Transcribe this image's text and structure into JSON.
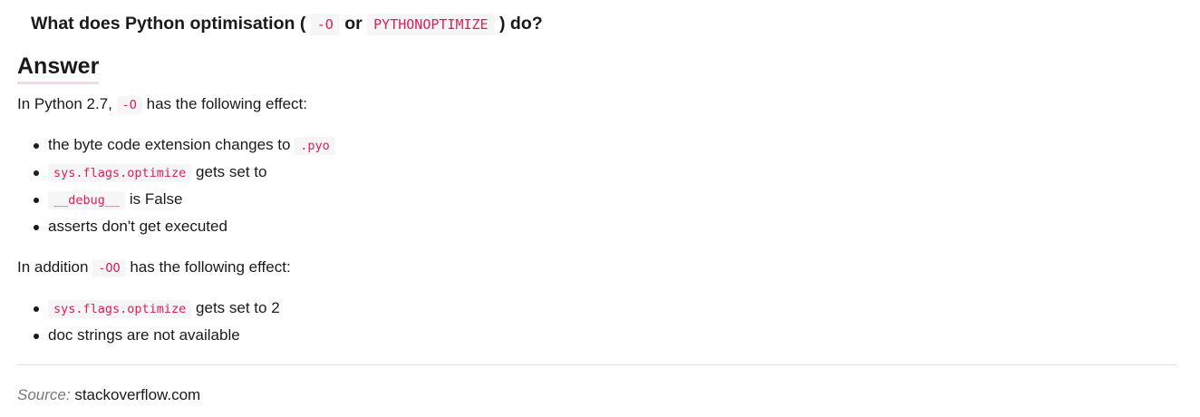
{
  "question": {
    "text_1": "What does Python optimisation (",
    "code_1": "-O",
    "text_2": "or",
    "code_2": "PYTHONOPTIMIZE",
    "text_3": ") do?"
  },
  "answer": {
    "heading": "Answer",
    "intro": {
      "text_1": "In Python 2.7,",
      "code_1": "-O",
      "text_2": "has the following effect:"
    },
    "effects_O": [
      {
        "text_1": "the byte code extension changes to",
        "code": ".pyo",
        "text_2": ""
      },
      {
        "text_1": "",
        "code": "sys.flags.optimize",
        "text_2": "gets set to"
      },
      {
        "text_1": "",
        "code": "__debug__",
        "text_2": "is False"
      },
      {
        "text_1": "asserts don't get executed",
        "code": "",
        "text_2": ""
      }
    ],
    "addition": {
      "text_1": "In addition",
      "code_1": "-OO",
      "text_2": "has the following effect:"
    },
    "effects_OO": [
      {
        "text_1": "",
        "code": "sys.flags.optimize",
        "text_2": "gets set to 2"
      },
      {
        "text_1": "doc strings are not available",
        "code": "",
        "text_2": ""
      }
    ]
  },
  "source": {
    "label": "Source:",
    "site": "stackoverflow.com"
  }
}
